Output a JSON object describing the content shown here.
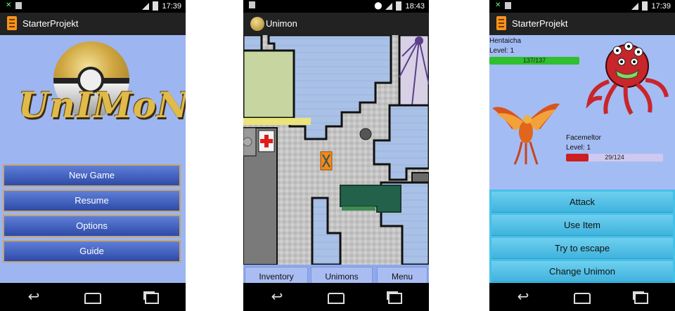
{
  "phone1": {
    "status": {
      "time": "17:39"
    },
    "app_title": "StarterProjekt",
    "logo_text": "UnIMoN",
    "menu": [
      "New Game",
      "Resume",
      "Options",
      "Guide"
    ]
  },
  "phone2": {
    "status": {
      "time": "18:43"
    },
    "app_title": "Unimon",
    "tabs": [
      "Inventory",
      "Unimons",
      "Menu"
    ]
  },
  "phone3": {
    "status": {
      "time": "17:39"
    },
    "app_title": "StarterProjekt",
    "enemy": {
      "name": "Hentaicha",
      "level": "Level: 1",
      "hp_text": "137/137",
      "hp_fraction": 1.0
    },
    "player": {
      "name": "Facemeltor",
      "level": "Level: 1",
      "hp_text": "29/124",
      "hp_fraction": 0.234
    },
    "actions": [
      "Attack",
      "Use Item",
      "Try to escape",
      "Change Unimon"
    ]
  },
  "colors": {
    "menu_bg": "#9db5f0",
    "hp_green": "#2fbf2f",
    "hp_red": "#cc1f1f",
    "action_blue": "#47c0e8"
  }
}
